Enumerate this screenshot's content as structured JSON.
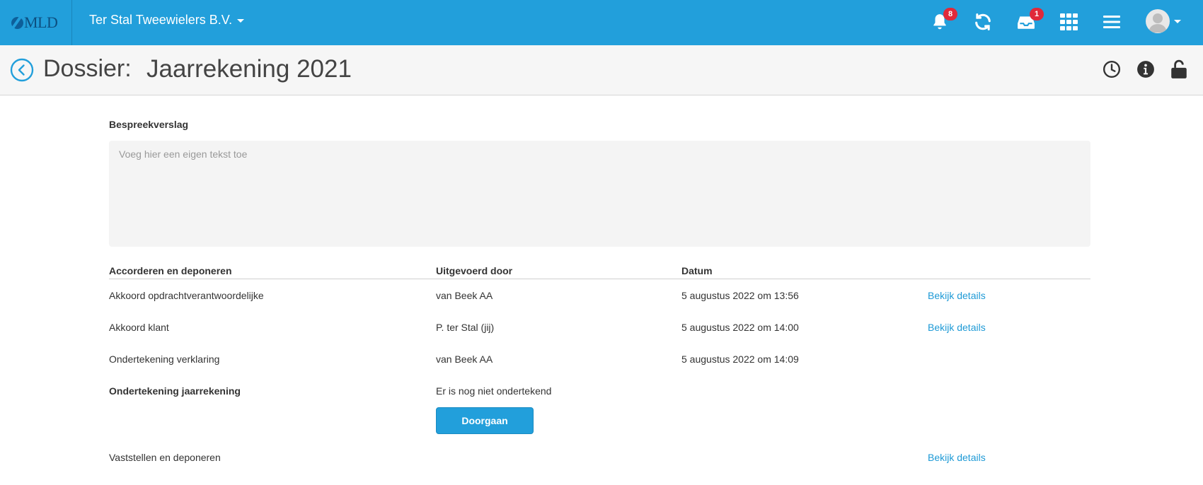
{
  "topbar": {
    "logo_text": "MLD",
    "company": "Ter Stal Tweewielers B.V.",
    "notifications_count": "8",
    "inbox_count": "1",
    "icons": [
      "bell-icon",
      "refresh-icon",
      "inbox-icon",
      "apps-grid-icon",
      "menu-icon",
      "user-avatar-icon"
    ],
    "color": "#229fdb"
  },
  "header": {
    "label": "Dossier:",
    "title": "Jaarrekening 2021",
    "icons": [
      "history-icon",
      "info-icon",
      "unlock-icon"
    ]
  },
  "notes": {
    "title": "Bespreekverslag",
    "placeholder": "Voeg hier een eigen tekst toe",
    "value": ""
  },
  "table": {
    "headers": [
      "Accorderen en deponeren",
      "Uitgevoerd door",
      "Datum",
      ""
    ],
    "rows": [
      {
        "step": "Akkoord opdrachtverantwoordelijke",
        "by": "van Beek AA",
        "date": "5 augustus 2022 om 13:56",
        "action": "Bekijk details"
      },
      {
        "step": "Akkoord klant",
        "by": "P. ter Stal (jij)",
        "date": "5 augustus 2022 om 14:00",
        "action": "Bekijk details"
      },
      {
        "step": "Ondertekening verklaring",
        "by": "van Beek AA",
        "date": "5 augustus 2022 om 14:09",
        "action": ""
      },
      {
        "step": "Ondertekening jaarrekening",
        "by": "Er is nog niet ondertekend",
        "date": "",
        "action": "",
        "button": "Doorgaan"
      },
      {
        "step": "Vaststellen en deponeren",
        "by": "",
        "date": "",
        "action": "Bekijk details"
      }
    ]
  },
  "colors": {
    "link": "#1e9ad6",
    "badge": "#e0293a"
  }
}
